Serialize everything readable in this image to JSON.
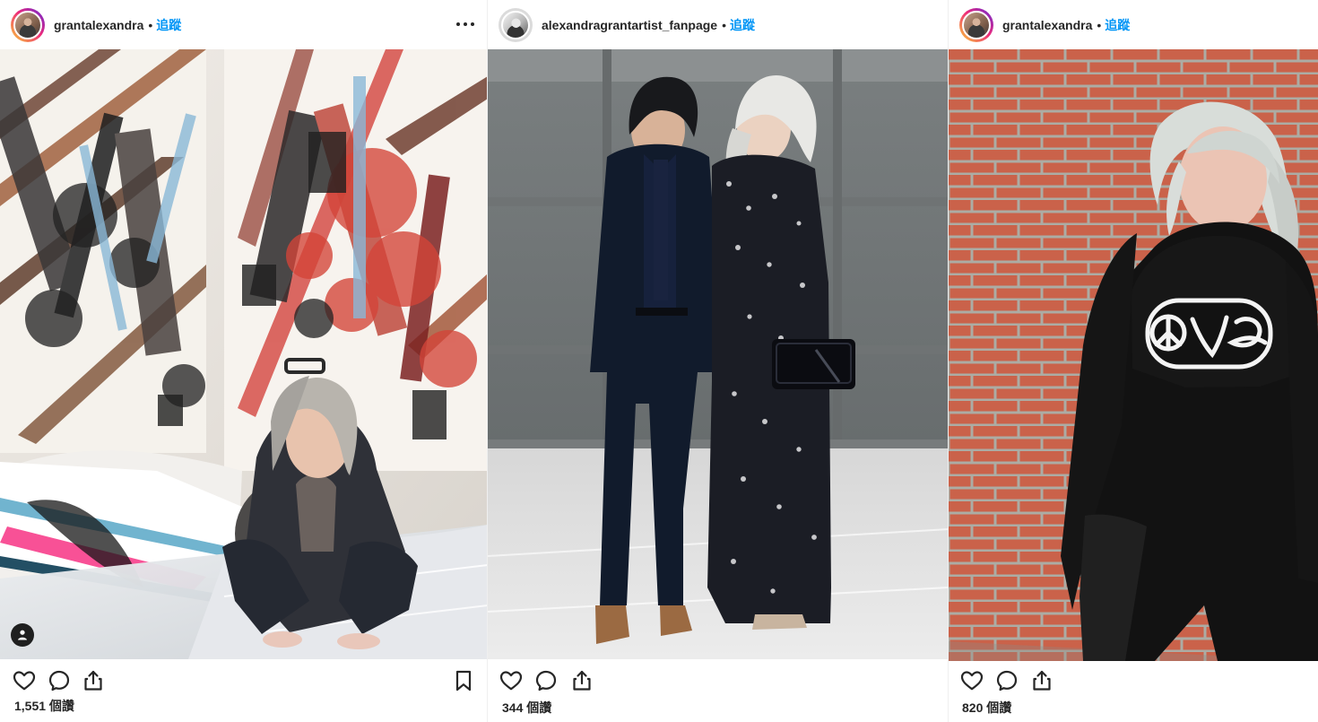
{
  "posts": [
    {
      "username": "grantalexandra",
      "dot": "•",
      "follow_label": "追蹤",
      "views": "1,551 個讚",
      "more_label": "•••",
      "avatar_style": "gradient-ring"
    },
    {
      "username": "alexandragrantartist_fanpage",
      "dot": "•",
      "follow_label": "追蹤",
      "views": "344 個讚",
      "avatar_style": "gray-ring"
    },
    {
      "username": "grantalexandra",
      "dot": "•",
      "follow_label": "追蹤",
      "views": "820 個讚",
      "avatar_style": "gradient-ring"
    }
  ],
  "icons": {
    "like": "heart-icon",
    "comment": "comment-icon",
    "share": "share-icon",
    "save": "bookmark-icon",
    "tagged_user": "user-tag-icon"
  },
  "colors": {
    "link": "#0095f6",
    "text": "#262626"
  }
}
